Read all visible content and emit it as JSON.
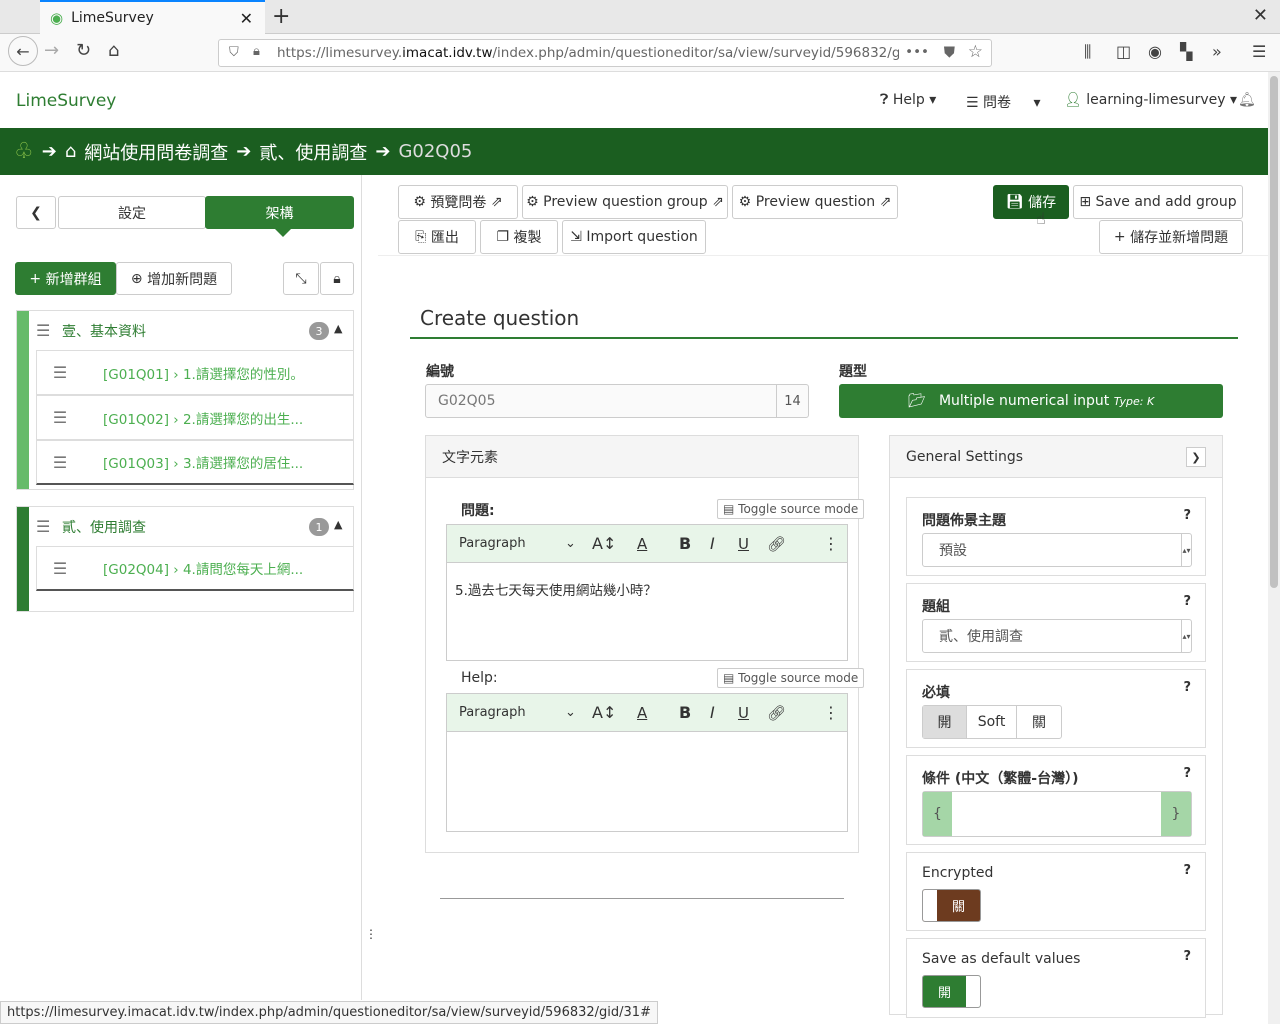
{
  "browser": {
    "tab_title": "LimeSurvey",
    "url_prefix": "https://limesurvey.",
    "url_domain": "imacat.idv.tw",
    "url_path": "/index.php/admin/questioneditor/sa/view/surveyid/596832/gid/",
    "status_url": "https://limesurvey.imacat.idv.tw/index.php/admin/questioneditor/sa/view/surveyid/596832/gid/31#"
  },
  "header": {
    "brand": "LimeSurvey",
    "help": "Help",
    "surveys": "問卷",
    "user": "learning-limesurvey"
  },
  "breadcrumb": {
    "survey": "網站使用問卷調查",
    "group": "貳、使用調查",
    "question": "G02Q05"
  },
  "sidebar": {
    "tab_settings": "設定",
    "tab_structure": "架構",
    "add_group": "新增群組",
    "add_question": "增加新問題",
    "groups": [
      {
        "title": "壹、基本資料",
        "count": "3",
        "questions": [
          "[G01Q01] › 1.請選擇您的性別。",
          "[G01Q02] › 2.請選擇您的出生...",
          "[G01Q03] › 3.請選擇您的居住..."
        ]
      },
      {
        "title": "貳、使用調查",
        "count": "1",
        "questions": [
          "[G02Q04] › 4.請問您每天上網..."
        ]
      }
    ]
  },
  "toolbar": {
    "preview_survey": "預覽問卷",
    "preview_group": "Preview question group",
    "preview_question": "Preview question",
    "export": "匯出",
    "copy": "複製",
    "import_question": "Import question",
    "save": "儲存",
    "save_add_group": "Save and add group",
    "save_add_question": "儲存並新增問題"
  },
  "form": {
    "title": "Create question",
    "code_label": "編號",
    "code_value": "G02Q05",
    "code_counter": "14",
    "type_label": "題型",
    "type_value": "Multiple numerical input",
    "type_code": "Type: K",
    "text_panel": "文字元素",
    "question_label": "問題:",
    "question_text": "5.過去七天每天使用網站幾小時？",
    "help_label": "Help:",
    "toggle_source": "Toggle source mode",
    "paragraph": "Paragraph"
  },
  "settings": {
    "header": "General Settings",
    "theme_label": "問題佈景主題",
    "theme_value": "預設",
    "group_label": "題組",
    "group_value": "貳、使用調查",
    "mandatory_label": "必填",
    "mandatory_on": "開",
    "mandatory_soft": "Soft",
    "mandatory_off": "關",
    "condition_label": "條件 (中文（繁體-台灣）)",
    "condition_open": "{",
    "condition_close": "}",
    "encrypted_label": "Encrypted",
    "encrypted_value": "關",
    "default_label": "Save as default values",
    "default_value": "開",
    "help_mark": "?"
  },
  "colors": {
    "brand_green": "#1b5e20",
    "accent_green": "#2e7d32",
    "encrypted_brown": "#6d3b1f"
  }
}
